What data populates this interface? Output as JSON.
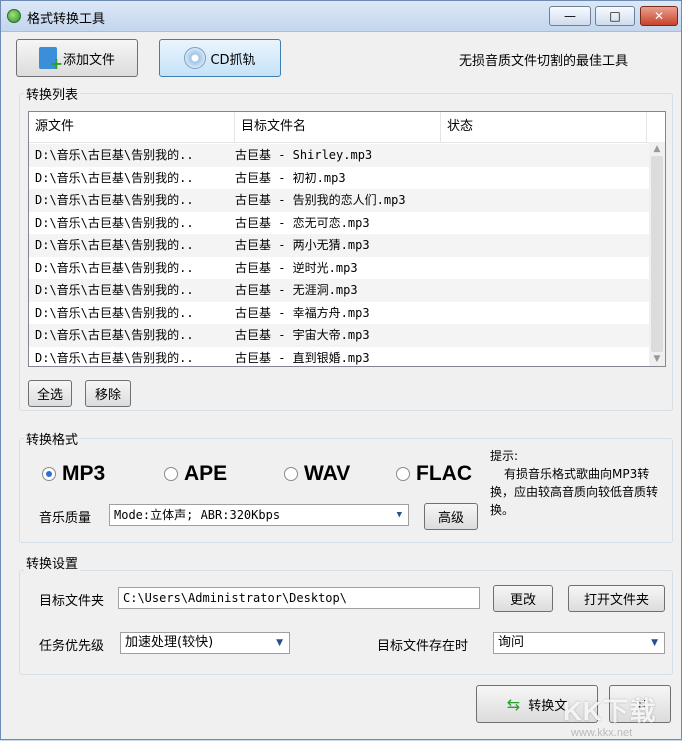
{
  "window": {
    "title": "格式转换工具",
    "min": "—",
    "max": "□",
    "close": "✕"
  },
  "toolbar": {
    "add_file": "添加文件",
    "cd_rip": "CD抓轨",
    "slogan": "无损音质文件切割的最佳工具"
  },
  "convert_list": {
    "label": "转换列表",
    "columns": [
      "源文件",
      "目标文件名",
      "状态"
    ],
    "rows": [
      [
        "D:\\音乐\\古巨基\\告别我的..",
        "古巨基 - Shirley.mp3"
      ],
      [
        "D:\\音乐\\古巨基\\告别我的..",
        "古巨基 - 初初.mp3"
      ],
      [
        "D:\\音乐\\古巨基\\告别我的..",
        "古巨基 - 告别我的恋人们.mp3"
      ],
      [
        "D:\\音乐\\古巨基\\告别我的..",
        "古巨基 - 恋无可恋.mp3"
      ],
      [
        "D:\\音乐\\古巨基\\告别我的..",
        "古巨基 - 两小无猜.mp3"
      ],
      [
        "D:\\音乐\\古巨基\\告别我的..",
        "古巨基 - 逆时光.mp3"
      ],
      [
        "D:\\音乐\\古巨基\\告别我的..",
        "古巨基 - 无涯洞.mp3"
      ],
      [
        "D:\\音乐\\古巨基\\告别我的..",
        "古巨基 - 幸福方舟.mp3"
      ],
      [
        "D:\\音乐\\古巨基\\告别我的..",
        "古巨基 - 宇宙大帝.mp3"
      ],
      [
        "D:\\音乐\\古巨基\\告别我的..",
        "古巨基 - 直到银婚.mp3"
      ]
    ],
    "select_all": "全选",
    "remove": "移除"
  },
  "format": {
    "label": "转换格式",
    "options": [
      "MP3",
      "APE",
      "WAV",
      "FLAC"
    ],
    "selected": "MP3",
    "quality_label": "音乐质量",
    "quality_value": "Mode:立体声; ABR:320Kbps",
    "advanced": "高级",
    "tip_title": "提示:",
    "tip_body": "有损音乐格式歌曲向MP3转换，应由较高音质向较低音质转换。"
  },
  "settings": {
    "label": "转换设置",
    "target_folder_label": "目标文件夹",
    "target_folder_value": "C:\\Users\\Administrator\\Desktop\\",
    "change": "更改",
    "open_folder": "打开文件夹",
    "priority_label": "任务优先级",
    "priority_value": "加速处理(较快)",
    "exists_label": "目标文件存在时",
    "exists_value": "询问"
  },
  "footer": {
    "convert": "转换文",
    "other": "下"
  },
  "watermark": {
    "logo": "KK下载",
    "url": "www.kkx.net"
  }
}
